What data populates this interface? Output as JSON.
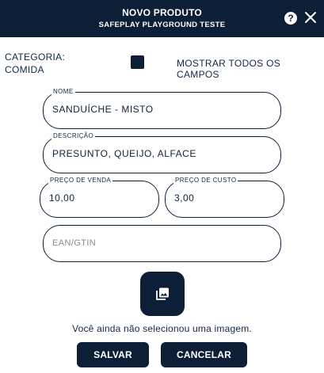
{
  "header": {
    "title": "NOVO PRODUTO",
    "subtitle": "SAFEPLAY PLAYGROUND TESTE",
    "help_glyph": "?",
    "help_icon": "help-circle-icon",
    "close_icon": "close-icon"
  },
  "category": {
    "label": "CATEGORIA:",
    "value": "COMIDA"
  },
  "options": {
    "show_all_label": "MOSTRAR TODOS OS CAMPOS",
    "show_all_checked": false
  },
  "form": {
    "name": {
      "label": "NOME",
      "value": "SANDUÍCHE - MISTO"
    },
    "description": {
      "label": "DESCRIÇÃO",
      "value": "PRESUNTO, QUEIJO, ALFACE"
    },
    "sale_price": {
      "label": "PREÇO DE VENDA",
      "value": "10,00"
    },
    "cost_price": {
      "label": "PREÇO DE CUSTO",
      "value": "3,00"
    },
    "ean": {
      "placeholder": "EAN/GTIN",
      "value": ""
    }
  },
  "image": {
    "icon": "image-gallery-icon",
    "message": "Você ainda não selecionou uma imagem."
  },
  "actions": {
    "save_label": "SALVAR",
    "cancel_label": "CANCELAR"
  },
  "colors": {
    "primary": "#0c1f36",
    "background": "#ffffff",
    "text": "#132843",
    "placeholder": "#7f8a96"
  }
}
